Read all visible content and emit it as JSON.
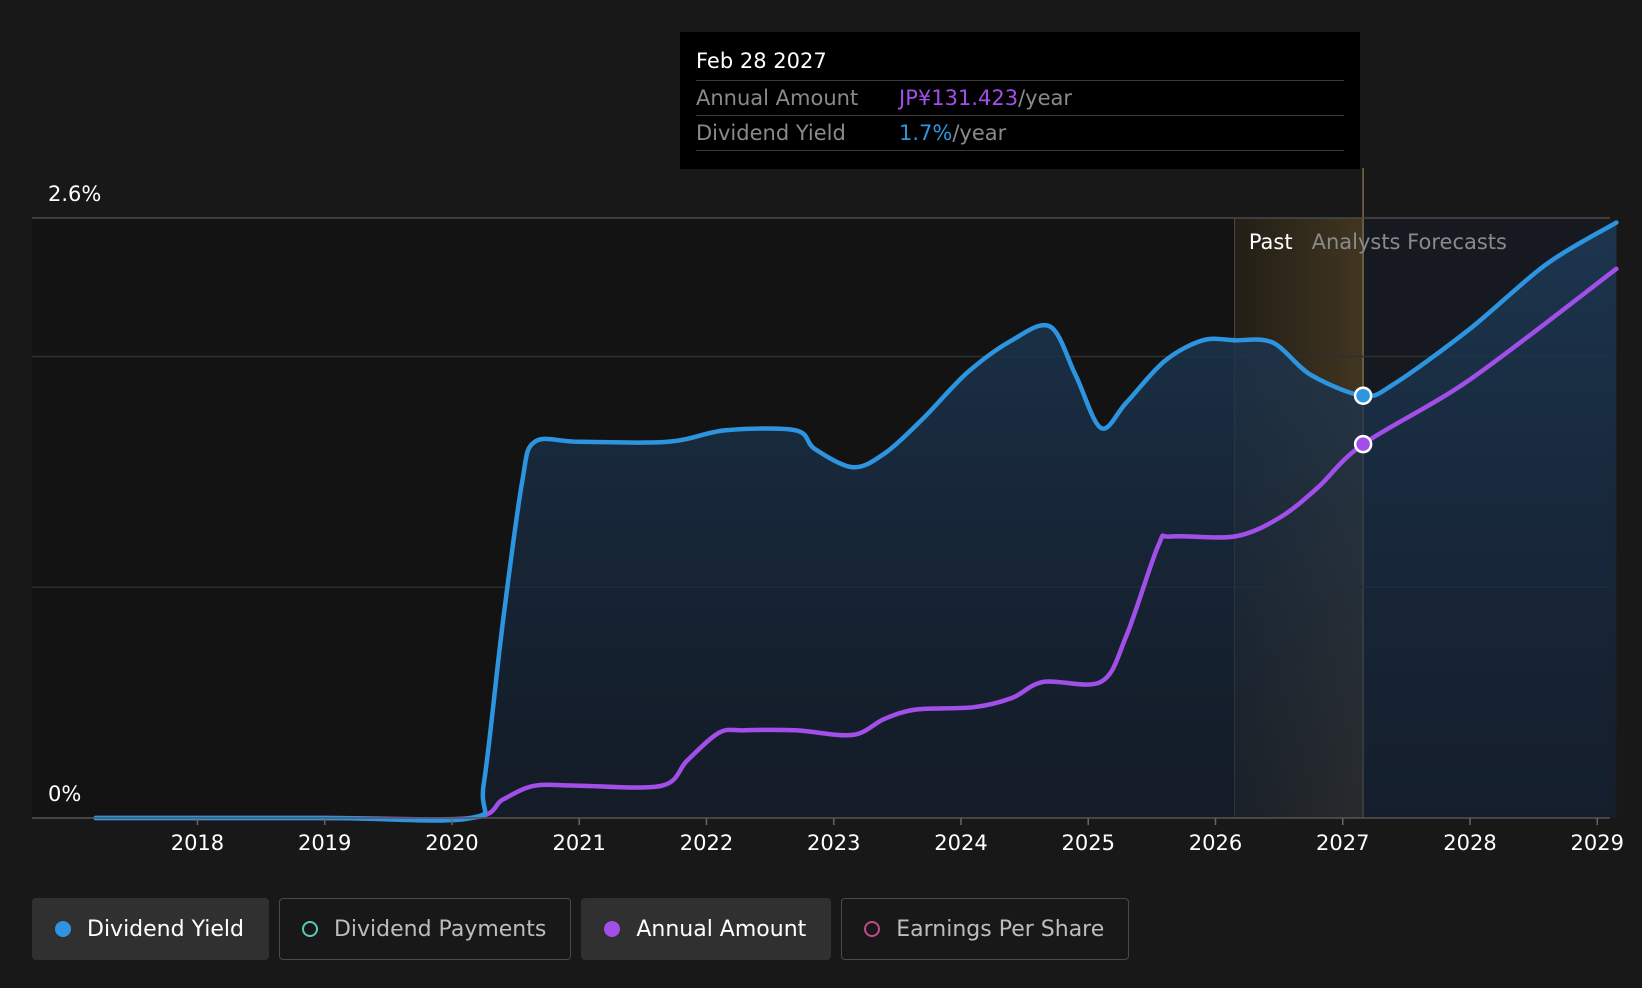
{
  "tooltip": {
    "date": "Feb 28 2027",
    "rows": [
      {
        "label": "Annual Amount",
        "value": "JP¥131.423",
        "unit": "/year",
        "color": "#a24ee9"
      },
      {
        "label": "Dividend Yield",
        "value": "1.7%",
        "unit": "/year",
        "color": "#2d95e0"
      }
    ]
  },
  "legend": [
    {
      "label": "Dividend Yield",
      "color": "#2d95e0",
      "filled": true,
      "active": true
    },
    {
      "label": "Dividend Payments",
      "color": "#5ec6b6",
      "filled": false,
      "active": false
    },
    {
      "label": "Annual Amount",
      "color": "#a24ee9",
      "filled": true,
      "active": true
    },
    {
      "label": "Earnings Per Share",
      "color": "#c04b8c",
      "filled": false,
      "active": false
    }
  ],
  "chart_data": {
    "type": "line",
    "y_axis_labels": [
      "2.6%",
      "0%"
    ],
    "ylim": [
      0,
      2.6
    ],
    "xlim": [
      2016.7,
      2029.1
    ],
    "x_ticks": [
      "2018",
      "2019",
      "2020",
      "2021",
      "2022",
      "2023",
      "2024",
      "2025",
      "2026",
      "2027",
      "2028",
      "2029"
    ],
    "regions": {
      "past_label": "Past",
      "forecast_label": "Analysts Forecasts",
      "past_end": 2026.15,
      "forecast_start": 2027.16
    },
    "grid": true,
    "series": [
      {
        "name": "Dividend Yield",
        "unit": "%",
        "color": "#2d95e0",
        "x": [
          2017.2,
          2019.0,
          2020.15,
          2020.25,
          2020.4,
          2020.55,
          2020.65,
          2021.0,
          2021.7,
          2022.15,
          2022.7,
          2022.85,
          2023.15,
          2023.4,
          2023.7,
          2024.05,
          2024.4,
          2024.7,
          2024.9,
          2025.1,
          2025.3,
          2025.6,
          2025.9,
          2026.15,
          2026.45,
          2026.75,
          2027.16,
          2027.4,
          2028.0,
          2028.6,
          2029.15
        ],
        "y": [
          0,
          0,
          0,
          0.15,
          0.85,
          1.45,
          1.63,
          1.63,
          1.63,
          1.68,
          1.68,
          1.6,
          1.52,
          1.58,
          1.73,
          1.93,
          2.07,
          2.13,
          1.92,
          1.69,
          1.8,
          1.98,
          2.07,
          2.07,
          2.06,
          1.92,
          1.83,
          1.88,
          2.12,
          2.4,
          2.58
        ]
      },
      {
        "name": "Annual Amount",
        "unit": "JP¥",
        "color": "#a24ee9",
        "x": [
          2017.2,
          2019.0,
          2020.15,
          2020.4,
          2020.65,
          2021.0,
          2021.65,
          2021.85,
          2022.1,
          2022.3,
          2022.7,
          2023.15,
          2023.4,
          2023.65,
          2024.1,
          2024.4,
          2024.65,
          2025.1,
          2025.3,
          2025.55,
          2025.65,
          2026.15,
          2026.5,
          2026.8,
          2027.16,
          2028.0,
          2029.15
        ],
        "y": [
          0,
          0,
          0,
          0.08,
          0.14,
          0.14,
          0.14,
          0.25,
          0.37,
          0.38,
          0.38,
          0.36,
          0.43,
          0.47,
          0.48,
          0.52,
          0.59,
          0.59,
          0.79,
          1.18,
          1.22,
          1.22,
          1.3,
          1.43,
          1.62,
          1.9,
          2.38
        ]
      }
    ],
    "highlight_x": 2027.16
  }
}
